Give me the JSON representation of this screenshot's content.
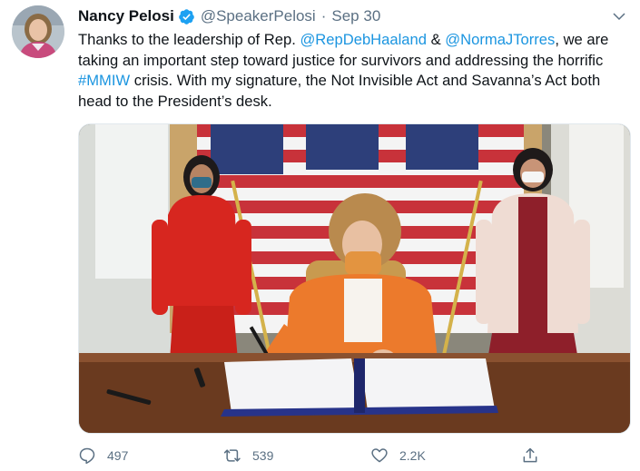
{
  "tweet": {
    "author_name": "Nancy Pelosi",
    "handle": "@SpeakerPelosi",
    "separator": "·",
    "timestamp": "Sep 30",
    "text": {
      "part1": "Thanks to the leadership of Rep. ",
      "mention1": "@RepDebHaaland",
      "part2": " & ",
      "mention2": "@NormaJTorres",
      "part3": ", we are taking an important step toward justice for survivors and addressing the horrific ",
      "hashtag": "#MMIW",
      "part4": " crisis. With my signature, the Not Invisible Act and Savanna’s Act both head to the President’s desk."
    }
  },
  "actions": {
    "replies": "497",
    "retweets": "539",
    "likes": "2.2K"
  },
  "icons": {
    "verified": "verified-badge-icon",
    "more": "chevron-down-icon",
    "reply": "reply-icon",
    "retweet": "retweet-icon",
    "like": "heart-icon",
    "share": "share-icon"
  },
  "colors": {
    "link": "#1b95e0",
    "muted": "#5b7083",
    "verified": "#1da1f2"
  }
}
